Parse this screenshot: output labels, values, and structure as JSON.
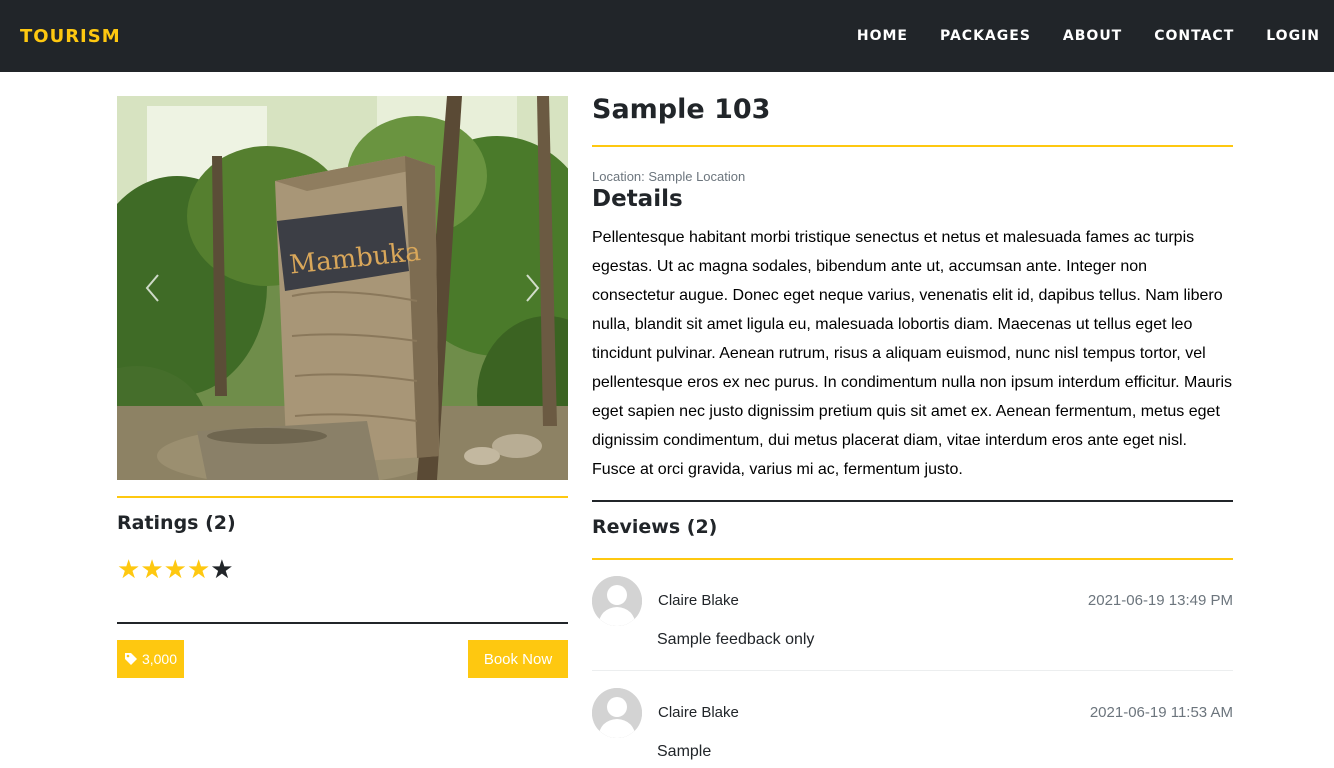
{
  "navbar": {
    "brand": "TOURISM",
    "links": [
      "HOME",
      "PACKAGES",
      "ABOUT",
      "CONTACT",
      "LOGIN"
    ]
  },
  "carousel": {
    "image_sign_text": "Mambuka",
    "prev_icon": "chevron-left-icon",
    "next_icon": "chevron-right-icon"
  },
  "ratings": {
    "title": "Ratings (2)",
    "value": 4,
    "max": 5,
    "filled_color": "#fec810",
    "empty_color": "#212529"
  },
  "price": {
    "icon": "tag-icon",
    "value": "3,000"
  },
  "book_button": "Book Now",
  "package": {
    "title": "Sample 103",
    "location": "Location: Sample Location",
    "details_title": "Details",
    "description": "Pellentesque habitant morbi tristique senectus et netus et malesuada fames ac turpis egestas. Ut ac magna sodales, bibendum ante ut, accumsan ante. Integer non consectetur augue. Donec eget neque varius, venenatis elit id, dapibus tellus. Nam libero nulla, blandit sit amet ligula eu, malesuada lobortis diam. Maecenas ut tellus eget leo tincidunt pulvinar. Aenean rutrum, risus a aliquam euismod, nunc nisl tempus tortor, vel pellentesque eros ex nec purus. In condimentum nulla non ipsum interdum efficitur. Mauris eget sapien nec justo dignissim pretium quis sit amet ex. Aenean fermentum, metus eget dignissim condimentum, dui metus placerat diam, vitae interdum eros ante eget nisl. Fusce at orci gravida, varius mi ac, fermentum justo."
  },
  "reviews": {
    "title": "Reviews (2)",
    "items": [
      {
        "name": "Claire Blake",
        "date": "2021-06-19 13:49 PM",
        "text": "Sample feedback only"
      },
      {
        "name": "Claire Blake",
        "date": "2021-06-19 11:53 AM",
        "text": "Sample"
      }
    ]
  },
  "colors": {
    "accent": "#fec810",
    "navbar_bg": "#212529"
  }
}
